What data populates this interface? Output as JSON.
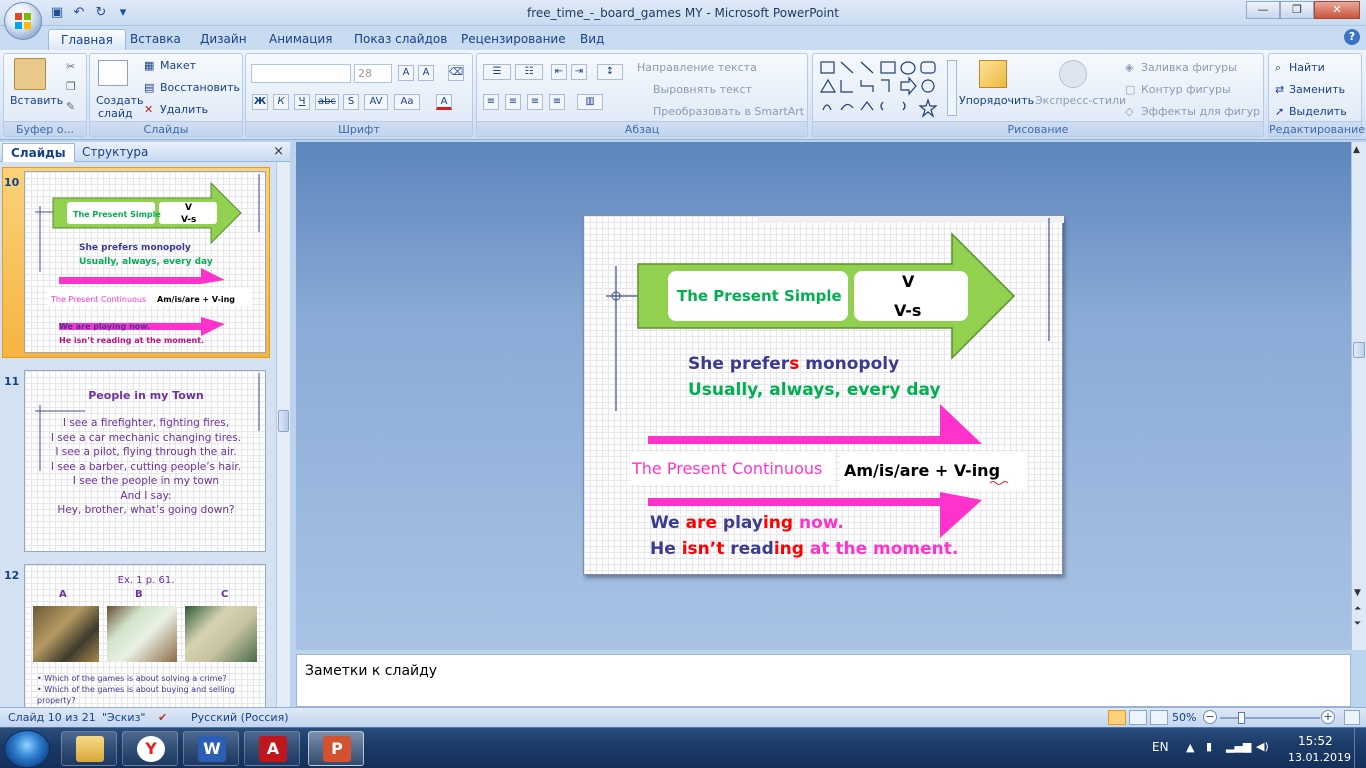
{
  "window": {
    "title": "free_time_-_board_games MY - Microsoft PowerPoint",
    "minimize": "—",
    "maximize": "❐",
    "close": "✕"
  },
  "qat": [
    "save-icon",
    "undo-icon",
    "redo-icon",
    "customize-icon"
  ],
  "tabs": [
    "Главная",
    "Вставка",
    "Дизайн",
    "Анимация",
    "Показ слайдов",
    "Рецензирование",
    "Вид"
  ],
  "ribbon": {
    "clipboard": {
      "label": "Буфер о...",
      "paste": "Вставить"
    },
    "slides": {
      "label": "Слайды",
      "new_slide_1": "Создать",
      "new_slide_2": "слайд",
      "layout": "Макет",
      "reset": "Восстановить",
      "delete": "Удалить"
    },
    "font": {
      "label": "Шрифт",
      "font_name": "",
      "font_size": "28"
    },
    "paragraph": {
      "label": "Абзац",
      "text_direction": "Направление текста",
      "align_text": "Выровнять текст",
      "smartart": "Преобразовать в SmartArt"
    },
    "drawing": {
      "label": "Рисование",
      "arrange": "Упорядочить",
      "quick_styles": "Экспресс-стили",
      "fill": "Заливка фигуры",
      "outline": "Контур фигуры",
      "effects": "Эффекты для фигур"
    },
    "editing": {
      "label": "Редактирование",
      "find": "Найти",
      "replace": "Заменить",
      "select": "Выделить"
    }
  },
  "pane": {
    "tab_slides": "Слайды",
    "tab_outline": "Структура",
    "close": "×"
  },
  "thumbnails": [
    {
      "number": "10",
      "simple": "The Present Simple",
      "v": "V",
      "vs": "V-s",
      "line1": "She  prefers  monopoly",
      "line2": "Usually, always,  every  day",
      "continuous": "The Present Continuous",
      "formula": "Am/is/are + V-ing",
      "ex1": "We are playing now.",
      "ex2": "He isn’t reading at the moment."
    },
    {
      "number": "11",
      "title": "People in my Town",
      "lines": [
        "I see a  firefighter, fighting fires,",
        "I see a car mechanic changing tires.",
        "I see a pilot, flying through the air.",
        "I see a barber, cutting people’s hair.",
        "I see the people in my town",
        "And I say:",
        "Hey, brother, what’s going down?"
      ]
    },
    {
      "number": "12",
      "title": "Ex. 1 p. 61.",
      "labels": [
        "A",
        "B",
        "C"
      ],
      "bullets": [
        "Which of the games is about  solving a crime?",
        "Which of the games is about buying and selling property?"
      ]
    }
  ],
  "slide": {
    "simple": "The Present Simple",
    "v": "V",
    "vs": "V-s",
    "line1_a": "She  prefer",
    "line1_b": "s",
    "line1_c": " monopoly",
    "line2": "Usually, always, every day",
    "continuous": "The Present Continuous",
    "formula": "Am/is/are + V-ing",
    "ex1_a": "We ",
    "ex1_b": "are",
    "ex1_c": " play",
    "ex1_d": "ing",
    "ex1_e": " now.",
    "ex2_a": "He ",
    "ex2_b": "isn’t",
    "ex2_c": " read",
    "ex2_d": "ing",
    "ex2_e": " at the moment."
  },
  "notes": {
    "placeholder": "Заметки к слайду"
  },
  "status": {
    "slide_info": "Слайд 10 из 21",
    "theme": "\"Эскиз\"",
    "language": "Русский (Россия)",
    "zoom": "50%"
  },
  "tray": {
    "lang": "EN",
    "time": "15:52",
    "date": "13.01.2019"
  },
  "colors": {
    "green_arrow": "#92d050",
    "green_text": "#00b050",
    "magenta": "#ff33cc",
    "navy_text": "#3b3b8f",
    "red_text": "#ff0000"
  }
}
